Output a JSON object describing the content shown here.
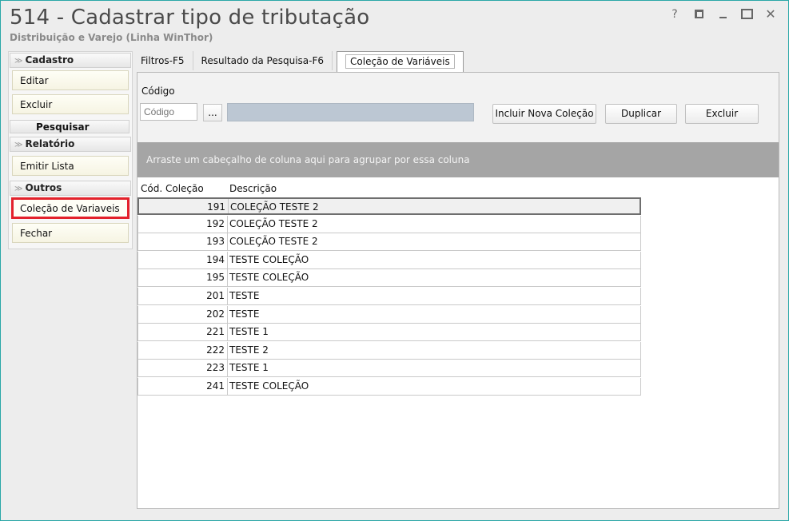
{
  "window": {
    "title": "514 - Cadastrar tipo de tributação",
    "subtitle": "Distribuição e Varejo (Linha WinThor)",
    "controls": {
      "help": "?"
    }
  },
  "sidebar": {
    "cadastro_header": "Cadastro",
    "editar": "Editar",
    "excluir": "Excluir",
    "pesquisar_header": "Pesquisar",
    "relatorio_header": "Relatório",
    "emitir_lista": "Emitir Lista",
    "outros_header": "Outros",
    "colecao_variaveis": "Coleção de Variaveis",
    "fechar": "Fechar"
  },
  "tabs": {
    "filtros": "Filtros-F5",
    "resultado": "Resultado da Pesquisa-F6",
    "colecao": "Coleção de Variáveis"
  },
  "form": {
    "codigo_label": "Código",
    "codigo_placeholder": "Código",
    "dots": "...",
    "incluir_button": "Incluir Nova Coleção",
    "duplicar_button": "Duplicar",
    "excluir_button": "Excluir"
  },
  "grid": {
    "group_hint": "Arraste um cabeçalho de coluna aqui para agrupar por essa coluna",
    "columns": [
      "Cód. Coleção",
      "Descrição"
    ],
    "rows": [
      [
        "191",
        "COLEÇÃO TESTE 2"
      ],
      [
        "192",
        "COLEÇÃO TESTE 2"
      ],
      [
        "193",
        "COLEÇÃO TESTE 2"
      ],
      [
        "194",
        "TESTE COLEÇÃO"
      ],
      [
        "195",
        "TESTE COLEÇÃO"
      ],
      [
        "201",
        "TESTE"
      ],
      [
        "202",
        "TESTE"
      ],
      [
        "221",
        "TESTE 1"
      ],
      [
        "222",
        "TESTE 2"
      ],
      [
        "223",
        "TESTE 1"
      ],
      [
        "241",
        "TESTE COLEÇÃO"
      ]
    ]
  },
  "colors": {
    "accent_frame": "#2aa7a7",
    "highlight": "#e3212b",
    "group_bar": "#a5a5a5"
  }
}
